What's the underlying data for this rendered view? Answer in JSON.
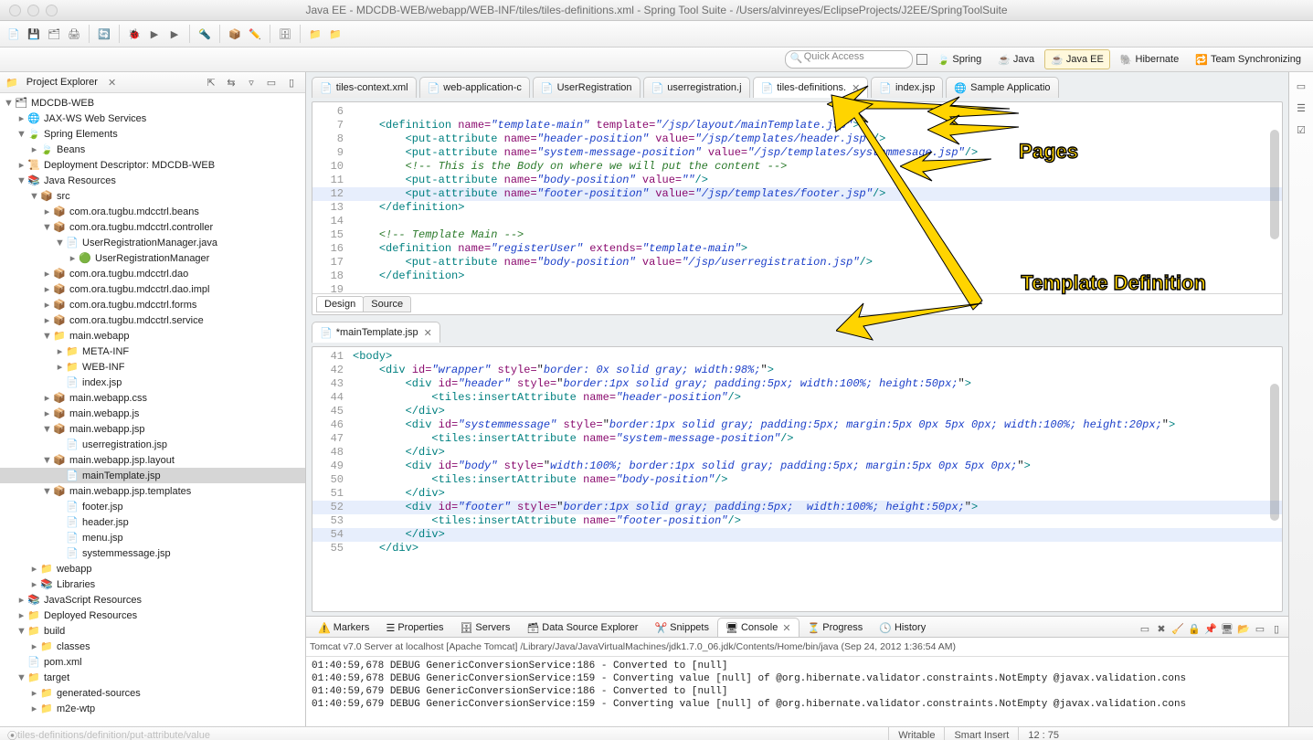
{
  "window": {
    "title": "Java EE - MDCDB-WEB/webapp/WEB-INF/tiles/tiles-definitions.xml - Spring Tool Suite - /Users/alvinreyes/EclipseProjects/J2EE/SpringToolSuite"
  },
  "quick_access": {
    "placeholder": "Quick Access"
  },
  "perspectives": {
    "spring": "Spring",
    "java": "Java",
    "javaee": "Java EE",
    "hibernate": "Hibernate",
    "team": "Team Synchronizing"
  },
  "explorer": {
    "title": "Project Explorer",
    "tree": {
      "project": "MDCDB-WEB",
      "jaxws": "JAX-WS Web Services",
      "spring_el": "Spring Elements",
      "beans": "Beans",
      "dep_desc": "Deployment Descriptor: MDCDB-WEB",
      "java_res": "Java Resources",
      "src": "src",
      "pkg_beans": "com.ora.tugbu.mdcctrl.beans",
      "pkg_ctrl": "com.ora.tugbu.mdcctrl.controller",
      "urm_java": "UserRegistrationManager.java",
      "urm_cls": "UserRegistrationManager",
      "pkg_dao": "com.ora.tugbu.mdcctrl.dao",
      "pkg_daoimpl": "com.ora.tugbu.mdcctrl.dao.impl",
      "pkg_forms": "com.ora.tugbu.mdcctrl.forms",
      "pkg_service": "com.ora.tugbu.mdcctrl.service",
      "main_webapp": "main.webapp",
      "meta_inf": "META-INF",
      "web_inf": "WEB-INF",
      "index_jsp": "index.jsp",
      "main_css": "main.webapp.css",
      "main_js": "main.webapp.js",
      "main_jsp": "main.webapp.jsp",
      "ur_jsp": "userregistration.jsp",
      "main_layout": "main.webapp.jsp.layout",
      "maintpl": "mainTemplate.jsp",
      "main_tpl": "main.webapp.jsp.templates",
      "footer": "footer.jsp",
      "header": "header.jsp",
      "menu": "menu.jsp",
      "sysmsg": "systemmessage.jsp",
      "webapp": "webapp",
      "libs": "Libraries",
      "jsres": "JavaScript Resources",
      "depres": "Deployed Resources",
      "build": "build",
      "classes": "classes",
      "pom": "pom.xml",
      "target": "target",
      "gensrc": "generated-sources",
      "m2e": "m2e-wtp"
    }
  },
  "editor_tabs": {
    "t0": "tiles-context.xml",
    "t1": "web-application-c",
    "t2": "UserRegistration",
    "t3": "userregistration.j",
    "t4": "tiles-definitions.",
    "t5": "index.jsp",
    "t6": "Sample Applicatio"
  },
  "code_top": {
    "ln6": "6",
    "ln7": "7",
    "l7": "<definition name=\"template-main\" template=\"/jsp/layout/mainTemplate.jsp\">",
    "ln8": "8",
    "l8": "    <put-attribute name=\"header-position\" value=\"/jsp/templates/header.jsp\"/>",
    "ln9": "9",
    "l9": "    <put-attribute name=\"system-message-position\" value=\"/jsp/templates/systemmesage.jsp\"/>",
    "ln10": "10",
    "l10": "    <!-- This is the Body on where we will put the content -->",
    "ln11": "11",
    "l11": "    <put-attribute name=\"body-position\" value=\"\"/>",
    "ln12": "12",
    "l12": "    <put-attribute name=\"footer-position\" value=\"/jsp/templates/footer.jsp\"/>",
    "ln13": "13",
    "l13": "</definition>",
    "ln14": "14",
    "ln15": "15",
    "l15": "<!-- Template Main -->",
    "ln16": "16",
    "l16": "<definition name=\"registerUser\" extends=\"template-main\">",
    "ln17": "17",
    "l17": "    <put-attribute name=\"body-position\" value=\"/jsp/userregistration.jsp\"/>",
    "ln18": "18",
    "l18": "</definition>",
    "ln19": "19"
  },
  "design_source": {
    "design": "Design",
    "source": "Source"
  },
  "editor2_tab": "*mainTemplate.jsp",
  "code_bot": {
    "ln41": "41",
    "l41": "<body>",
    "ln42": "42",
    "l42": "    <div id=\"wrapper\" style=\"border: 0x solid gray; width:98%;\">",
    "ln43": "43",
    "l43": "        <div id=\"header\" style=\"border:1px solid gray; padding:5px; width:100%; height:50px;\">",
    "ln44": "44",
    "l44": "            <tiles:insertAttribute name=\"header-position\"/>",
    "ln45": "45",
    "l45": "        </div>",
    "ln46": "46",
    "l46": "        <div id=\"systemmessage\" style=\"border:1px solid gray; padding:5px; margin:5px 0px 5px 0px; width:100%; height:20px;\">",
    "ln47": "47",
    "l47": "            <tiles:insertAttribute name=\"system-message-position\"/>",
    "ln48": "48",
    "l48": "        </div>",
    "ln49": "49",
    "l49": "        <div id=\"body\" style=\"width:100%; border:1px solid gray; padding:5px; margin:5px 0px 5px 0px;\">",
    "ln50": "50",
    "l50": "            <tiles:insertAttribute name=\"body-position\"/>",
    "ln51": "51",
    "l51": "        </div>",
    "ln52": "52",
    "l52": "        <div id=\"footer\" style=\"border:1px solid gray; padding:5px;  width:100%; height:50px;\">",
    "ln53": "53",
    "l53": "            <tiles:insertAttribute name=\"footer-position\"/>",
    "ln54": "54",
    "l54": "        </div>",
    "ln55": "55",
    "l55": "    </div>"
  },
  "bottom_views": {
    "markers": "Markers",
    "properties": "Properties",
    "servers": "Servers",
    "dse": "Data Source Explorer",
    "snippets": "Snippets",
    "console": "Console",
    "progress": "Progress",
    "history": "History"
  },
  "console": {
    "header": "Tomcat v7.0 Server at localhost [Apache Tomcat] /Library/Java/JavaVirtualMachines/jdk1.7.0_06.jdk/Contents/Home/bin/java (Sep 24, 2012 1:36:54 AM)",
    "l1": "01:40:59,678 DEBUG GenericConversionService:186 - Converted to [null]",
    "l2": "01:40:59,678 DEBUG GenericConversionService:159 - Converting value [null] of @org.hibernate.validator.constraints.NotEmpty @javax.validation.cons",
    "l3": "01:40:59,679 DEBUG GenericConversionService:186 - Converted to [null]",
    "l4": "01:40:59,679 DEBUG GenericConversionService:159 - Converting value [null] of @org.hibernate.validator.constraints.NotEmpty @javax.validation.cons"
  },
  "status": {
    "path": "tiles-definitions/definition/put-attribute/value",
    "writable": "Writable",
    "insert": "Smart Insert",
    "pos": "12 : 75"
  },
  "annotations": {
    "pages": "Pages",
    "tpl": "Template Definition"
  }
}
